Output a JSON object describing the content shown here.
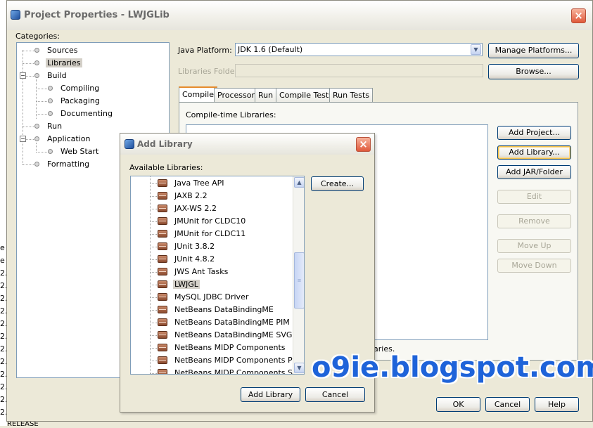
{
  "background": {
    "lines": [
      "e",
      "e",
      "2.",
      "2.",
      "2.",
      "2.",
      "2.",
      "2.",
      "2.",
      "2.",
      "2.",
      "2.",
      "2.",
      "2.",
      "RELEASE"
    ]
  },
  "main_dialog": {
    "title": "Project Properties - LWJGLib",
    "categories_label": "Categories:",
    "tree": [
      {
        "label": "Sources",
        "level": 0
      },
      {
        "label": "Libraries",
        "level": 0,
        "selected": true
      },
      {
        "label": "Build",
        "level": 0,
        "expanded": true
      },
      {
        "label": "Compiling",
        "level": 1
      },
      {
        "label": "Packaging",
        "level": 1
      },
      {
        "label": "Documenting",
        "level": 1
      },
      {
        "label": "Run",
        "level": 0
      },
      {
        "label": "Application",
        "level": 0,
        "expanded": true
      },
      {
        "label": "Web Start",
        "level": 1
      },
      {
        "label": "Formatting",
        "level": 0
      }
    ],
    "java_platform_label": "Java Platform:",
    "java_platform_value": "JDK 1.6 (Default)",
    "manage_platforms_label": "Manage Platforms...",
    "libraries_folder_label": "Libraries Folder:",
    "browse_label": "Browse...",
    "tabs": [
      "Compile",
      "Processor",
      "Run",
      "Compile Tests",
      "Run Tests"
    ],
    "active_tab": "Compile",
    "compile_time_label": "Compile-time Libraries:",
    "side_buttons": {
      "add_project": "Add Project...",
      "add_library": "Add Library...",
      "add_jar": "Add JAR/Folder",
      "edit": "Edit",
      "remove": "Remove",
      "move_up": "Move Up",
      "move_down": "Move Down"
    },
    "hint_fragment": "aries.",
    "ok_label": "OK",
    "cancel_label": "Cancel",
    "help_label": "Help"
  },
  "lib_dialog": {
    "title": "Add Library",
    "available_label": "Available Libraries:",
    "create_label": "Create...",
    "libraries": [
      "Java Tree API",
      "JAXB 2.2",
      "JAX-WS 2.2",
      "JMUnit for CLDC10",
      "JMUnit for CLDC11",
      "JUnit 3.8.2",
      "JUnit 4.8.2",
      "JWS Ant Tasks",
      "LWJGL",
      "MySQL JDBC Driver",
      "NetBeans DataBindingME",
      "NetBeans DataBindingME PIM",
      "NetBeans DataBindingME SVG",
      "NetBeans MIDP Components",
      "NetBeans MIDP Components PDA",
      "NetBeans MIDP Components SVG"
    ],
    "selected_library": "LWJGL",
    "add_library_label": "Add Library",
    "cancel_label": "Cancel"
  },
  "watermark": "o9ie.blogspot.com",
  "colors": {
    "dialog_bg": "#ece9d8",
    "watermark": "#1e63d9",
    "close": "#e0593b"
  }
}
